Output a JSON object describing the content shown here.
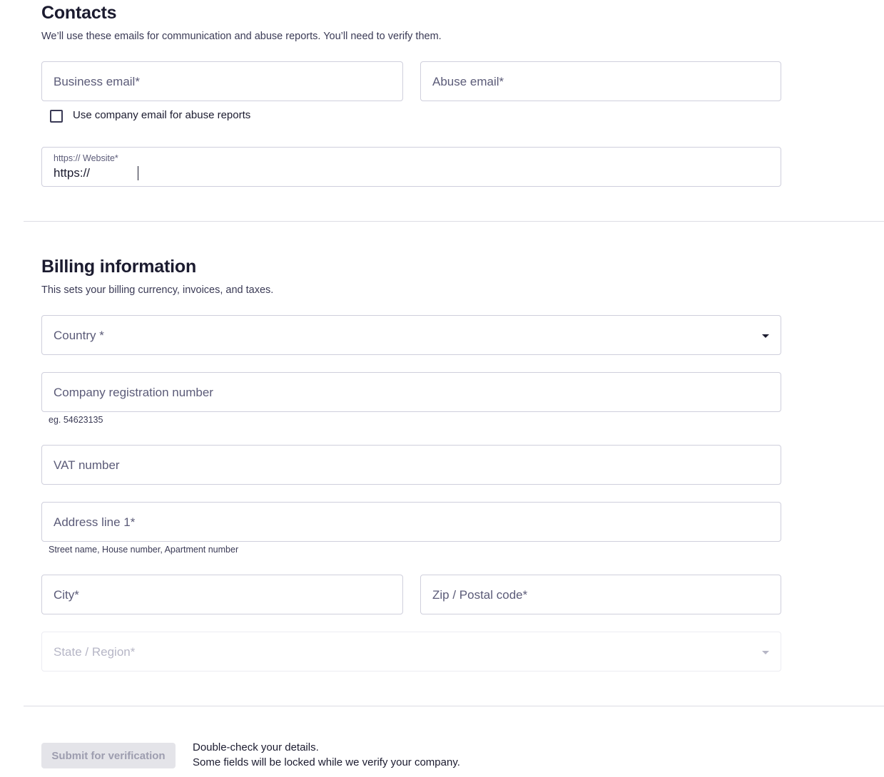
{
  "contacts": {
    "title": "Contacts",
    "description": "We’ll use these emails for communication and abuse reports. You’ll need to verify them.",
    "business_email": {
      "placeholder": "Business email*"
    },
    "abuse_email": {
      "placeholder": "Abuse email*"
    },
    "use_company_email": {
      "label": "Use company email for abuse reports",
      "checked": false
    },
    "website": {
      "label": "https:// Website*",
      "value": "https://"
    }
  },
  "billing": {
    "title": "Billing information",
    "description": "This sets your billing currency, invoices, and taxes.",
    "country": {
      "placeholder": "Country *",
      "icon": "chevron-down-icon"
    },
    "company_registration": {
      "placeholder": "Company registration number",
      "helper": "eg. 54623135"
    },
    "vat": {
      "placeholder": "VAT number"
    },
    "address_line_1": {
      "placeholder": "Address line 1*",
      "helper": "Street name, House number, Apartment number"
    },
    "city": {
      "placeholder": "City*"
    },
    "zip": {
      "placeholder": "Zip / Postal code*"
    },
    "state": {
      "placeholder": "State / Region*",
      "disabled": true,
      "icon": "chevron-down-icon"
    }
  },
  "footer": {
    "submit_label": "Submit for verification",
    "submit_disabled": true,
    "note_line1": "Double-check your details.",
    "note_line2": "Some fields will be locked while we verify your company."
  }
}
